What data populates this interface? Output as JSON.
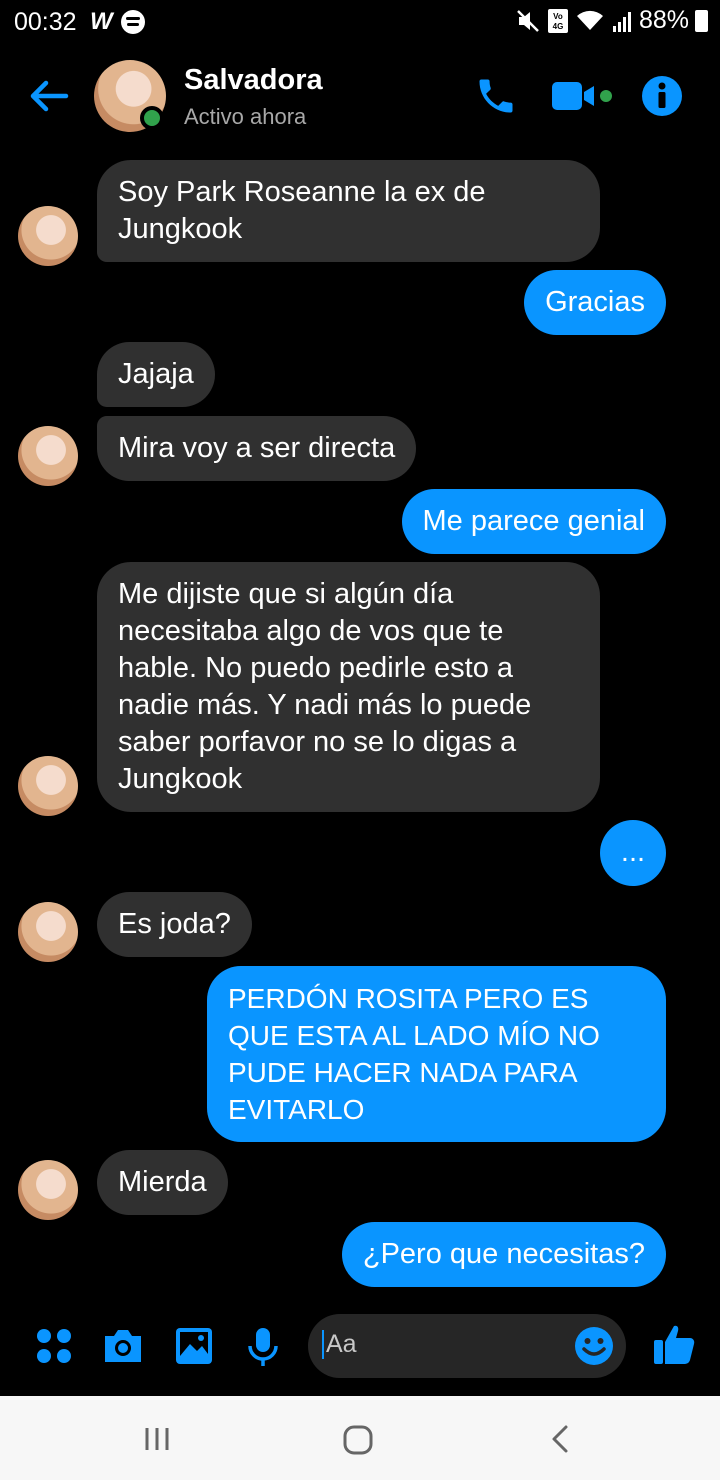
{
  "status_bar": {
    "time": "00:32",
    "left_icons": [
      "w-app-icon",
      "spotify-icon"
    ],
    "right_icons": [
      "mute-icon",
      "volte-4g-icon",
      "wifi-icon",
      "signal-icon"
    ],
    "battery": "88%"
  },
  "header": {
    "contact_name": "Salvadora",
    "contact_status": "Activo ahora",
    "accent_color": "#0a95ff",
    "online_color": "#31a24c"
  },
  "messages": [
    {
      "side": "in",
      "text": "Soy Park Roseanne la ex de Jungkook"
    },
    {
      "side": "out",
      "text": "Gracias"
    },
    {
      "side": "in",
      "text": "Jajaja"
    },
    {
      "side": "in",
      "text": "Mira voy a ser directa"
    },
    {
      "side": "out",
      "text": "Me parece genial"
    },
    {
      "side": "in",
      "text": "Me dijiste que si algún día necesitaba algo de vos que te hable. No puedo pedirle esto a nadie más. Y nadi más lo puede saber porfavor no se lo digas a Jungkook"
    },
    {
      "side": "out",
      "text": "..."
    },
    {
      "side": "in",
      "text": "Es joda?"
    },
    {
      "side": "out",
      "text": "PERDÓN ROSITA PERO ES QUE ESTA AL LADO MÍO NO PUDE HACER NADA PARA EVITARLO"
    },
    {
      "side": "in",
      "text": "Mierda"
    },
    {
      "side": "out",
      "text": "¿Pero que necesitas?"
    }
  ],
  "composer": {
    "placeholder": "Aa",
    "icons": [
      "menu-dots-icon",
      "camera-icon",
      "gallery-icon",
      "microphone-icon",
      "emoji-icon",
      "like-icon"
    ]
  },
  "nav_bar": {
    "icons": [
      "recent-apps-icon",
      "home-icon",
      "back-nav-icon"
    ]
  }
}
